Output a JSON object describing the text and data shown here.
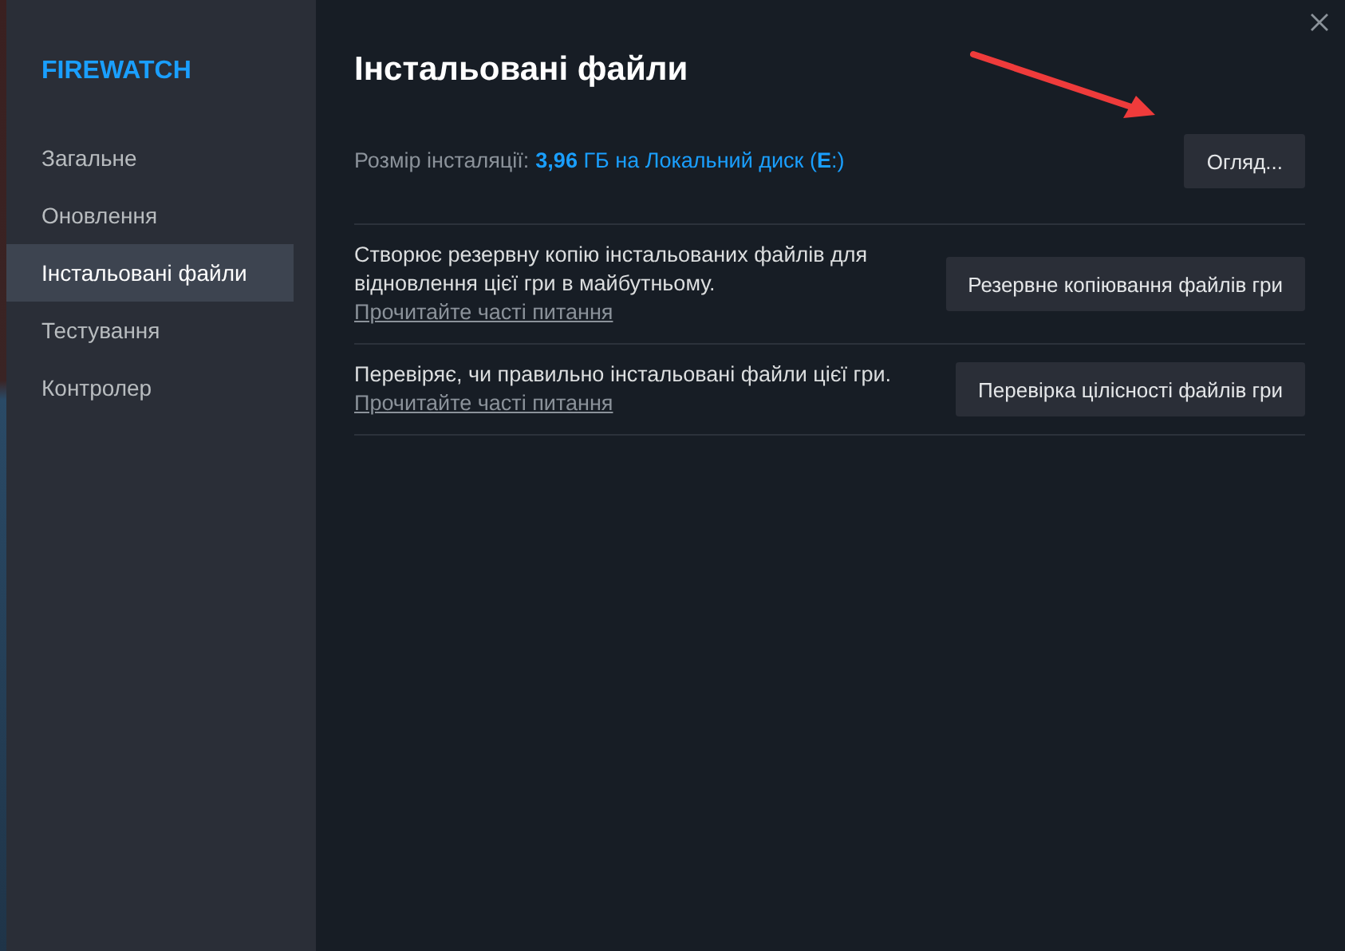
{
  "sidebar": {
    "game_title": "FIREWATCH",
    "items": [
      {
        "label": "Загальне",
        "selected": false
      },
      {
        "label": "Оновлення",
        "selected": false
      },
      {
        "label": "Інстальовані файли",
        "selected": true
      },
      {
        "label": "Тестування",
        "selected": false
      },
      {
        "label": "Контролер",
        "selected": false
      }
    ]
  },
  "content": {
    "title": "Інстальовані файли",
    "size_label": "Розмір інсталяції:",
    "size_value": "**3,96** ГБ на Локальний диск (**E**:)",
    "browse_button": "Огляд...",
    "actions": [
      {
        "description": "Створює резервну копію інстальованих файлів для відновлення цієї гри в майбутньому.",
        "link": "Прочитайте часті питання",
        "button": "Резервне копіювання файлів гри"
      },
      {
        "description": "Перевіряє, чи правильно інстальовані файли цієї гри.",
        "link": "Прочитайте часті питання",
        "button": "Перевірка цілісності файлів гри"
      }
    ]
  }
}
